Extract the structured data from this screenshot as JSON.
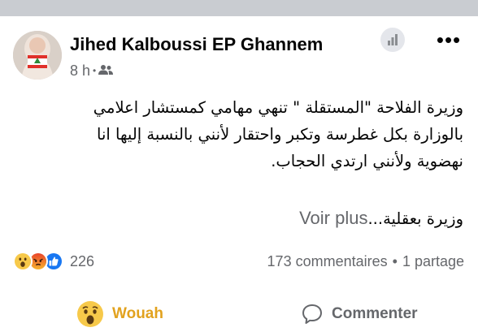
{
  "post": {
    "author": "Jihed Kalboussi EP Ghannem",
    "time": "8 h",
    "meta_separator": "•",
    "audience_icon": "friends-icon",
    "more_label": "•••",
    "text_lines": [
      "وزيرة الفلاحة \"المستقلة \" تنهي مهامي كمستشار اعلامي",
      "بالوزارة بكل غطرسة وتكبر واحتقار لأنني بالنسبة إليها انا",
      "نهضوية ولأنني ارتدي الحجاب."
    ],
    "last_line": "وزيرة بعقلية...",
    "see_more": "Voir plus"
  },
  "reactions": {
    "icons": [
      "wow-icon",
      "angry-icon",
      "like-icon"
    ],
    "count": "226",
    "comments": "173 commentaires",
    "separator": "•",
    "shares": "1 partage"
  },
  "actions": {
    "reaction_label": "Wouah",
    "comment_label": "Commenter"
  },
  "colors": {
    "divider": "#c9ccd1",
    "secondary_text": "#65676b",
    "wouah": "#e2a21e",
    "like_blue": "#1877f2",
    "angry_red": "#e9710f"
  }
}
